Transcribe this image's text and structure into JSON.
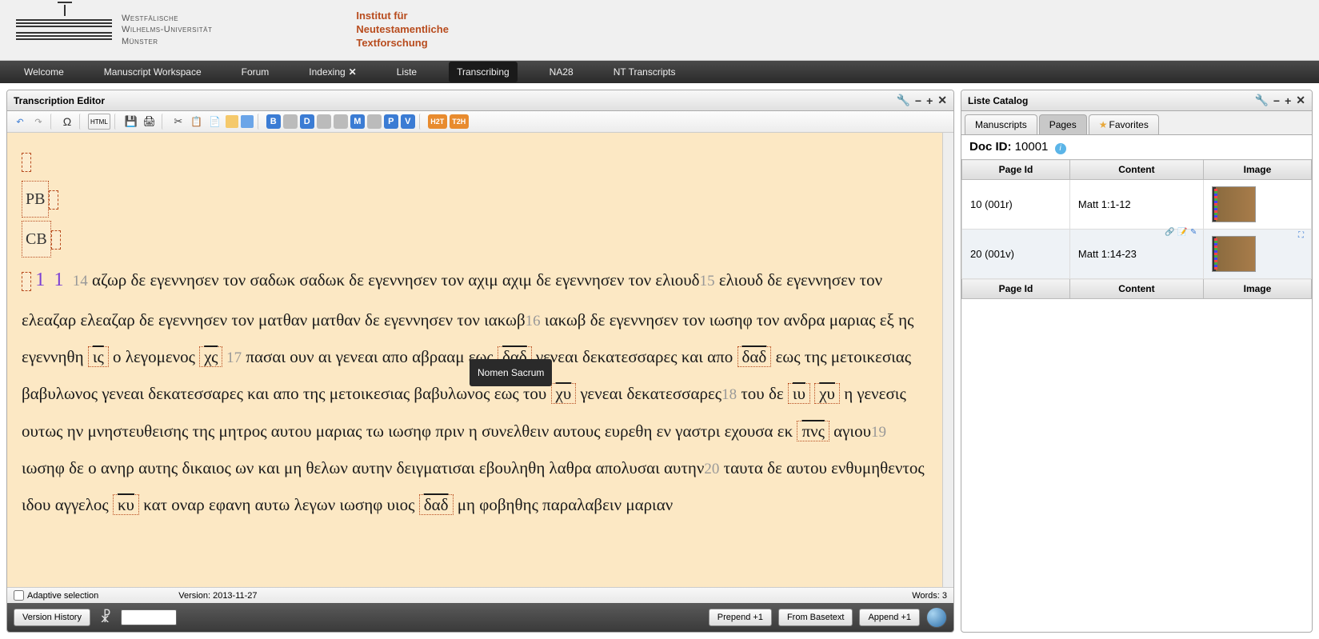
{
  "header": {
    "university": "Westfälische\nWilhelms-Universität\nMünster",
    "institute": "Institut für\nNeutestamentliche\nTextforschung"
  },
  "nav": {
    "items": [
      "Welcome",
      "Manuscript Workspace",
      "Forum",
      "Indexing",
      "Liste",
      "Transcribing",
      "NA28",
      "NT Transcripts"
    ],
    "closable_index": 3,
    "active_index": 5
  },
  "editor": {
    "title": "Transcription Editor",
    "toolbar": {
      "html_label": "HTML",
      "badges": [
        "B",
        "",
        "D",
        "",
        "",
        "M",
        "",
        "P",
        "V"
      ],
      "orange": [
        "H2T",
        "T2H"
      ]
    },
    "markers": {
      "pb": "PB",
      "cb": "CB"
    },
    "chapter": "1",
    "verse_start": "1",
    "transcript_lines": {
      "v14": "14",
      "t14a": " αζωρ δε εγεννησεν τον σαδωκ σαδωκ δε εγεννησεν τον αχιμ αχιμ δε εγεννησεν τον ελιουδ",
      "v15": "15",
      "t15": " ελιουδ δε εγεννησεν τον ελεαζαρ ελεαζαρ δε εγεννησεν τον ματθαν ματθαν δε εγεννησεν τον ιακωβ",
      "v16": "16",
      "t16a": " ιακωβ δε εγεννησεν τον ιωσηφ τον ανδρα μαριας εξ ης εγεννηθη ",
      "ns_is": "ις",
      "t16b": " ο λεγομενος ",
      "ns_xs": "χς",
      "v17": " 17",
      "t17a": " πασαι ουν αι γενεαι απο αβρααμ εως ",
      "ns_dad1": "δαδ",
      "t17b": " γενεαι δεκατεσσαρες και απο ",
      "ns_dad2": "δαδ",
      "t17c": " εως της μετοικεσιας βαβυλωνος γενεαι δεκατεσσαρες και απο της μετοικεσιας βαβυλωνος εως του ",
      "ns_xu1": "χυ",
      "t17d": " γενεαι δεκατεσσαρες",
      "v18": "18",
      "t18a": " του δε ",
      "ns_iu": "ιυ",
      "ns_xu2": "χυ",
      "t18b": " η γενεσις ουτως ην μνηστευθεισης της μητρος αυτου μαριας τω ιωσηφ πριν η συνελθειν αυτους ευρεθη εν γαστρι εχουσα εκ ",
      "ns_pns": "πνς",
      "t18c": " αγιου",
      "v19": "19",
      "t19": " ιωσηφ δε ο ανηρ αυτης δικαιος ων και μη θελων αυτην δειγματισαι εβουληθη λαθρα απολυσαι αυτην",
      "v20": "20",
      "t20a": " ταυτα δε αυτου ενθυμηθεντος ιδου αγγελος ",
      "ns_ku": "κυ",
      "t20b": " κατ οναρ εφανη αυτω λεγων ιωσηφ υιος ",
      "ns_dad3": "δαδ",
      "t20c": " μη φοβηθης παραλαβειν μαριαν"
    },
    "tooltip": "Nomen Sacrum",
    "status": {
      "adaptive": "Adaptive selection",
      "version": "Version: 2013-11-27",
      "words": "Words: 3"
    },
    "footer": {
      "version_history": "Version History",
      "prepend": "Prepend +1",
      "basetext": "From Basetext",
      "append": "Append +1"
    }
  },
  "catalog": {
    "title": "Liste Catalog",
    "tabs": [
      "Manuscripts",
      "Pages",
      "Favorites"
    ],
    "active_tab": 1,
    "doc_label": "Doc ID:",
    "doc_id": "10001",
    "columns": [
      "Page Id",
      "Content",
      "Image"
    ],
    "rows": [
      {
        "page": "10 (001r)",
        "content": "Matt 1:1-12",
        "active": false
      },
      {
        "page": "20 (001v)",
        "content": "Matt 1:14-23",
        "active": true
      }
    ]
  }
}
